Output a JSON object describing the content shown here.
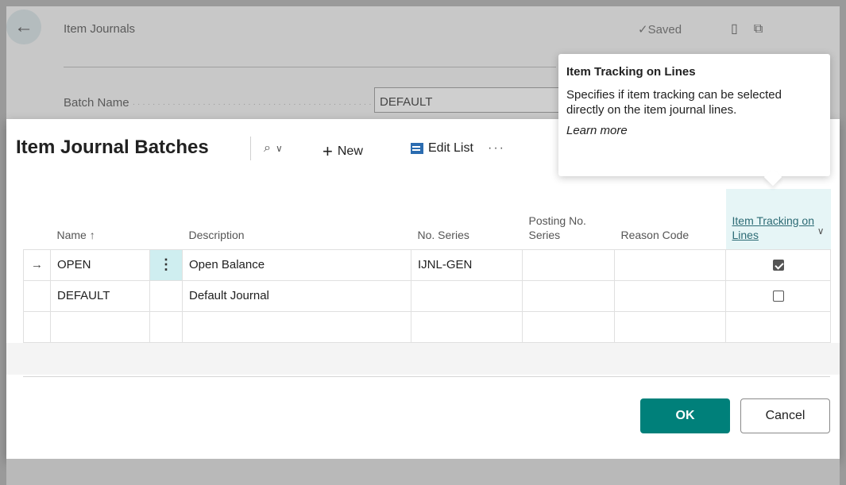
{
  "background": {
    "back_icon": "←",
    "title": "Item Journals",
    "saved_label": "✓Saved",
    "batch_label": "Batch Name",
    "batch_value": "DEFAULT"
  },
  "dialog": {
    "title": "Item Journal Batches",
    "toolbar": {
      "search_icon": "⌕",
      "search_chevron": "∨",
      "new_label": "New",
      "edit_list_label": "Edit List",
      "more_label": "···"
    },
    "columns": {
      "name": "Name ↑",
      "description": "Description",
      "no_series": "No. Series",
      "posting_no_series": "Posting No. Series",
      "reason_code": "Reason Code",
      "item_tracking": "Item Tracking on Lines"
    },
    "rows": [
      {
        "arrow": "→",
        "menu": "⋮",
        "name": "OPEN",
        "description": "Open Balance",
        "no_series": "IJNL-GEN",
        "posting_no_series": "",
        "reason_code": "",
        "item_tracking": true
      },
      {
        "arrow": "",
        "menu": "",
        "name": "DEFAULT",
        "description": "Default Journal",
        "no_series": "",
        "posting_no_series": "",
        "reason_code": "",
        "item_tracking": false
      },
      {
        "arrow": "",
        "menu": "",
        "name": "",
        "description": "",
        "no_series": "",
        "posting_no_series": "",
        "reason_code": "",
        "item_tracking": null
      }
    ],
    "buttons": {
      "ok": "OK",
      "cancel": "Cancel"
    }
  },
  "tooltip": {
    "title": "Item Tracking on Lines",
    "body": "Specifies if item tracking can be selected directly on the item journal lines.",
    "link": "Learn more"
  },
  "colors": {
    "accent": "#00807a",
    "selected_column": "#e6f5f6",
    "row_menu": "#cfeef0"
  }
}
